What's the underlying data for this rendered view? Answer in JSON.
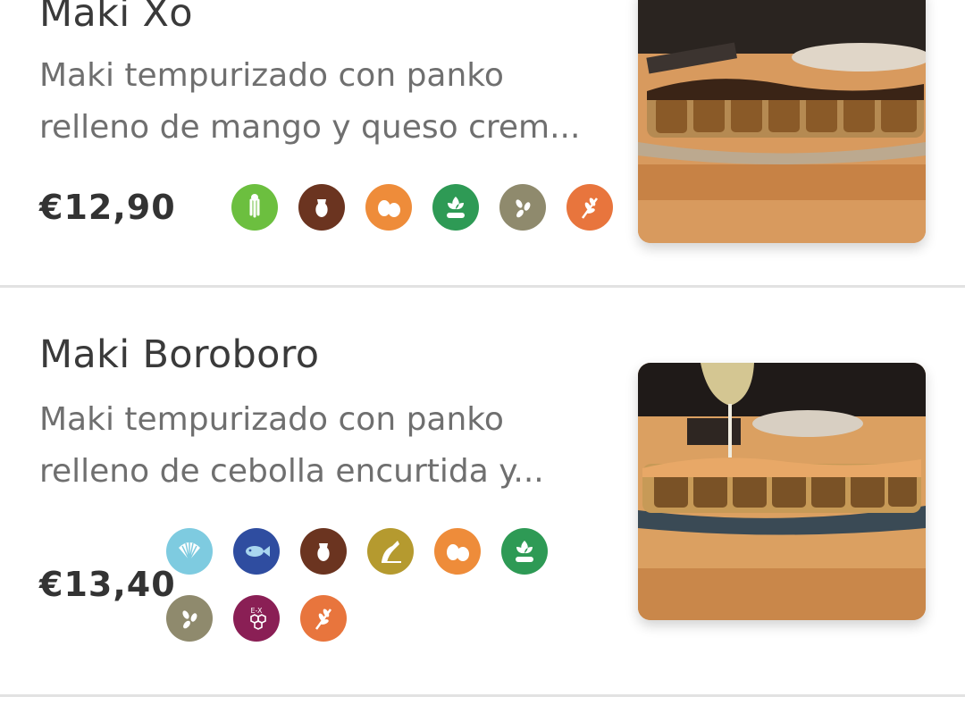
{
  "items": [
    {
      "name": "Maki Xo",
      "description_lines": [
        "Maki tempurizado con panko",
        "relleno de mango y queso crem..."
      ],
      "price": "€12,90",
      "allergens": [
        {
          "icon": "celery-icon",
          "color": "#6cbf3f"
        },
        {
          "icon": "milk-jug-icon",
          "color": "#6b3420"
        },
        {
          "icon": "eggs-icon",
          "color": "#ee8c3a"
        },
        {
          "icon": "soy-icon",
          "color": "#2e9a55"
        },
        {
          "icon": "sesame-icon",
          "color": "#8f8a6d"
        },
        {
          "icon": "gluten-icon",
          "color": "#e8753d"
        }
      ],
      "image": "maki-xo-photo"
    },
    {
      "name": "Maki Boroboro",
      "description_lines": [
        "Maki tempurizado con panko",
        "relleno de cebolla encurtida y..."
      ],
      "price": "€13,40",
      "allergens": [
        {
          "icon": "shellfish-icon",
          "color": "#7ecbe0"
        },
        {
          "icon": "fish-icon",
          "color": "#2f4da0"
        },
        {
          "icon": "milk-jug-icon",
          "color": "#6b3420"
        },
        {
          "icon": "sulphites-icon",
          "color": "#b59a2f"
        },
        {
          "icon": "eggs-icon",
          "color": "#ee8c3a"
        },
        {
          "icon": "soy-icon",
          "color": "#2e9a55"
        },
        {
          "icon": "sesame-icon",
          "color": "#8f8a6d"
        },
        {
          "icon": "additives-icon",
          "color": "#8a1f55",
          "text": "E-X"
        },
        {
          "icon": "gluten-icon",
          "color": "#e8753d"
        }
      ],
      "image": "maki-boroboro-photo"
    }
  ]
}
